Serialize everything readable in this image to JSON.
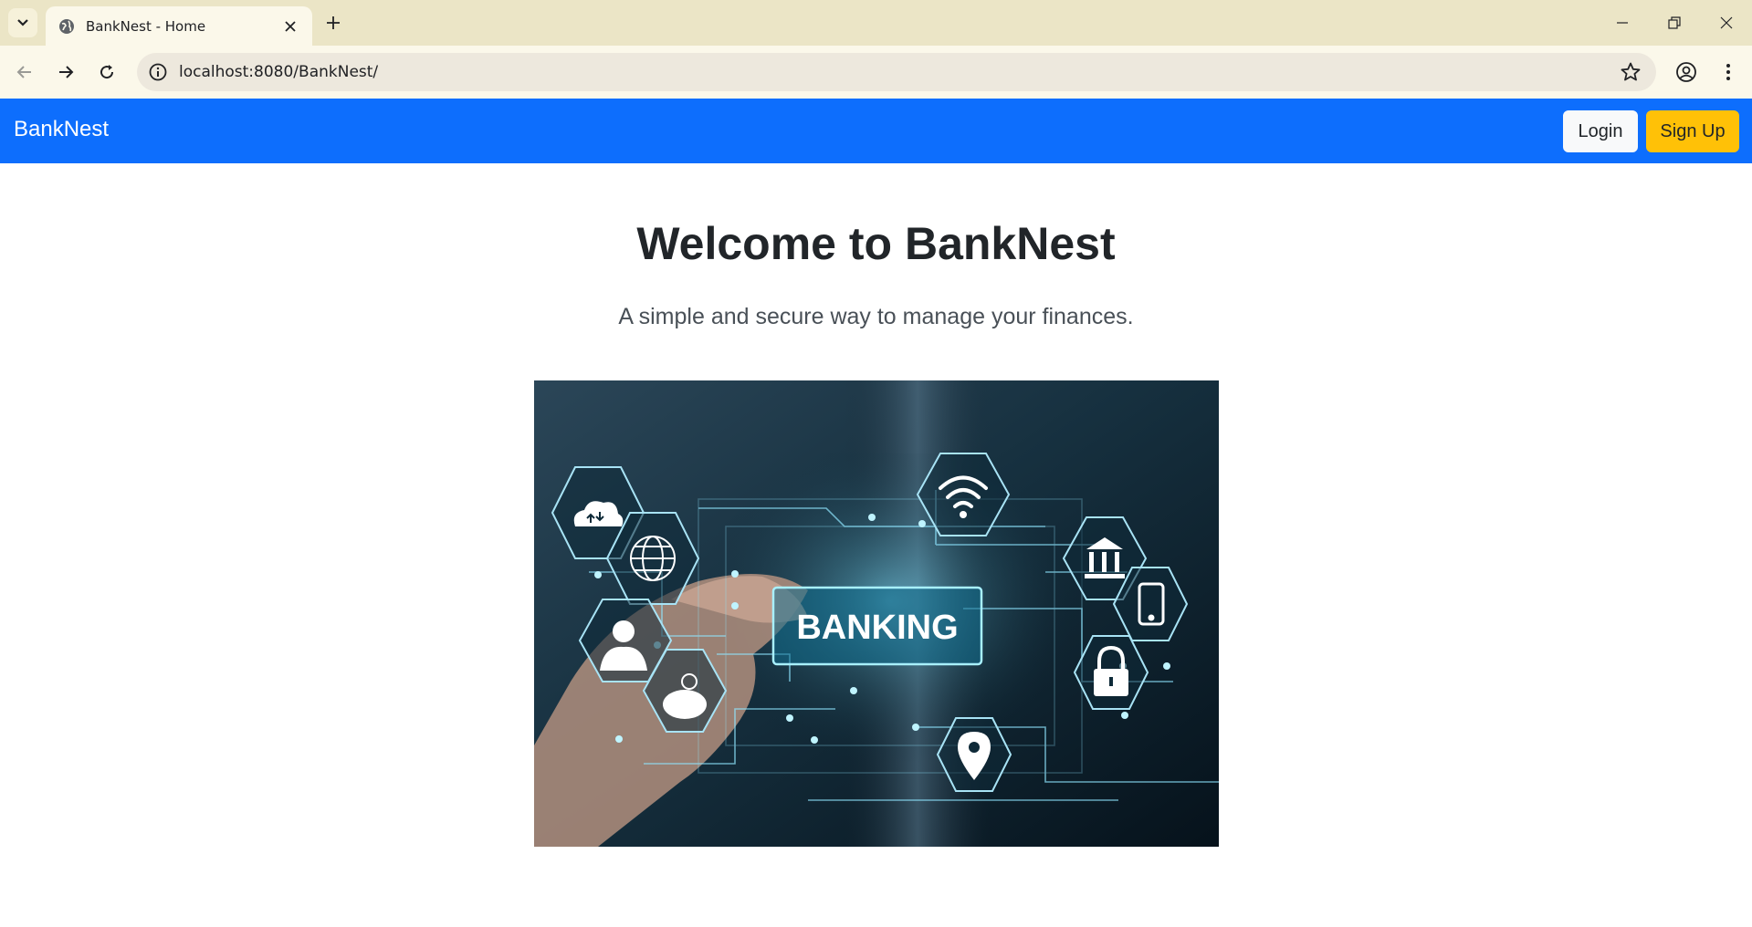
{
  "browser": {
    "tab_title": "BankNest - Home",
    "url": "localhost:8080/BankNest/"
  },
  "navbar": {
    "brand": "BankNest",
    "login_label": "Login",
    "signup_label": "Sign Up"
  },
  "hero": {
    "title": "Welcome to BankNest",
    "subtitle": "A simple and secure way to manage your finances.",
    "image_text": "BANKING"
  },
  "colors": {
    "navbar_bg": "#0d6efd",
    "signup_bg": "#ffc107",
    "tabbar_bg": "#ebe5c6"
  }
}
